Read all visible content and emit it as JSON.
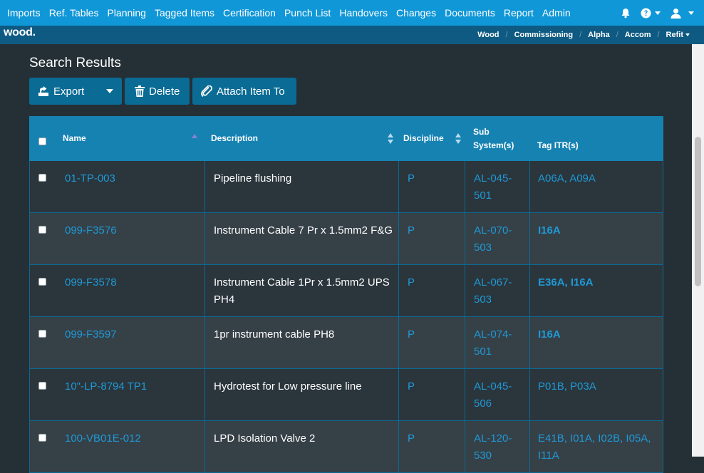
{
  "nav": {
    "items": [
      "Imports",
      "Ref. Tables",
      "Planning",
      "Tagged Items",
      "Certification",
      "Punch List",
      "Handovers",
      "Changes",
      "Documents",
      "Report",
      "Admin"
    ],
    "icons": [
      "bell-icon",
      "help-icon",
      "user-icon"
    ]
  },
  "subbar": {
    "logo": "wood.",
    "breadcrumb": [
      "Wood",
      "Commissioning",
      "Alpha",
      "Accom",
      "Refit"
    ]
  },
  "page": {
    "title": "Search Results"
  },
  "toolbar": {
    "export_label": "Export",
    "delete_label": "Delete",
    "attach_label": "Attach Item To"
  },
  "table": {
    "headers": {
      "name": "Name",
      "description": "Description",
      "discipline": "Discipline",
      "subsystem_line1": "Sub",
      "subsystem_line2": "System(s)",
      "tag_itr": "Tag ITR(s)"
    },
    "rows": [
      {
        "name": "01-TP-003",
        "description": "Pipeline flushing",
        "discipline": "P",
        "subsystem": "AL-045-501",
        "itr": "A06A, A09A",
        "itr_bold": false
      },
      {
        "name": "099-F3576",
        "description": "Instrument Cable 7 Pr x 1.5mm2 F&G",
        "discipline": "P",
        "subsystem": "AL-070-503",
        "itr": "I16A",
        "itr_bold": true
      },
      {
        "name": "099-F3578",
        "description": "Instrument Cable 1Pr x 1.5mm2 UPS PH4",
        "discipline": "P",
        "subsystem": "AL-067-503",
        "itr": "E36A, I16A",
        "itr_bold": true
      },
      {
        "name": "099-F3597",
        "description": "1pr instrument cable PH8",
        "discipline": "P",
        "subsystem": "AL-074-501",
        "itr": "I16A",
        "itr_bold": true
      },
      {
        "name": "10\"-LP-8794 TP1",
        "description": "Hydrotest for Low pressure line",
        "discipline": "P",
        "subsystem": "AL-045-506",
        "itr": "P01B, P03A",
        "itr_bold": false
      },
      {
        "name": "100-VB01E-012",
        "description": "LPD Isolation Valve 2",
        "discipline": "P",
        "subsystem": "AL-120-530",
        "itr": "E41B, I01A, I02B, I05A, I11A",
        "itr_bold": false
      }
    ]
  },
  "colors": {
    "topnav": "#1097d8",
    "subbar": "#0e5a82",
    "background": "#252f36",
    "table_header": "#1682b2",
    "link": "#1e9ad6",
    "button": "#0a6b95"
  }
}
